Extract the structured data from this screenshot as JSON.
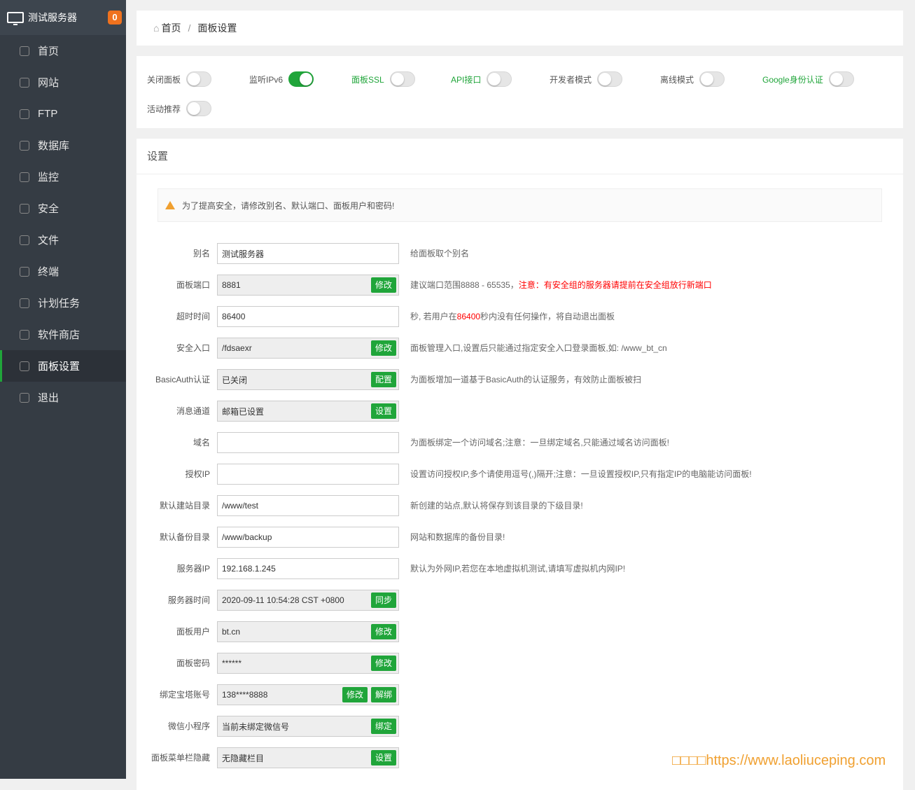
{
  "sidebar": {
    "server_name": "测试服务器",
    "badge": "0",
    "items": [
      {
        "label": "首页",
        "icon": "home-icon"
      },
      {
        "label": "网站",
        "icon": "globe-icon"
      },
      {
        "label": "FTP",
        "icon": "ftp-icon"
      },
      {
        "label": "数据库",
        "icon": "database-icon"
      },
      {
        "label": "监控",
        "icon": "monitor-icon"
      },
      {
        "label": "安全",
        "icon": "shield-icon"
      },
      {
        "label": "文件",
        "icon": "folder-icon"
      },
      {
        "label": "终端",
        "icon": "terminal-icon"
      },
      {
        "label": "计划任务",
        "icon": "calendar-icon"
      },
      {
        "label": "软件商店",
        "icon": "grid-icon"
      },
      {
        "label": "面板设置",
        "icon": "gear-icon",
        "active": true
      },
      {
        "label": "退出",
        "icon": "logout-icon"
      }
    ]
  },
  "breadcrumb": {
    "home": "首页",
    "sep": "/",
    "current": "面板设置"
  },
  "toggles": [
    {
      "label": "关闭面板",
      "on": false,
      "green": false
    },
    {
      "label": "监听IPv6",
      "on": true,
      "green": false
    },
    {
      "label": "面板SSL",
      "on": false,
      "green": true
    },
    {
      "label": "API接口",
      "on": false,
      "green": true
    },
    {
      "label": "开发者模式",
      "on": false,
      "green": false
    },
    {
      "label": "离线模式",
      "on": false,
      "green": false
    },
    {
      "label": "Google身份认证",
      "on": false,
      "green": true
    },
    {
      "label": "活动推荐",
      "on": false,
      "green": false
    }
  ],
  "settings": {
    "title": "设置",
    "alert": "为了提高安全，请修改别名、默认端口、面板用户和密码!",
    "rows": [
      {
        "label": "别名",
        "value": "测试服务器",
        "ro": false,
        "buttons": [],
        "help": [
          {
            "t": "给面板取个别名"
          }
        ]
      },
      {
        "label": "面板端口",
        "value": "8881",
        "ro": true,
        "buttons": [
          "修改"
        ],
        "help": [
          {
            "t": "建议端口范围8888 - 65535，"
          },
          {
            "t": "注意：有安全组的服务器请提前在安全组放行新端口",
            "red": true
          }
        ]
      },
      {
        "label": "超时时间",
        "value": "86400",
        "ro": false,
        "buttons": [],
        "help": [
          {
            "t": " 秒, 若用户在"
          },
          {
            "t": "86400",
            "red": true
          },
          {
            "t": "秒内没有任何操作，将自动退出面板"
          }
        ]
      },
      {
        "label": "安全入口",
        "value": "/fdsaexr",
        "ro": true,
        "buttons": [
          "修改"
        ],
        "help": [
          {
            "t": "面板管理入口,设置后只能通过指定安全入口登录面板,如: /www_bt_cn"
          }
        ]
      },
      {
        "label": "BasicAuth认证",
        "value": "已关闭",
        "ro": true,
        "buttons": [
          "配置"
        ],
        "help": [
          {
            "t": "为面板增加一道基于BasicAuth的认证服务，有效防止面板被扫"
          }
        ]
      },
      {
        "label": "消息通道",
        "value": "邮箱已设置",
        "ro": true,
        "buttons": [
          "设置"
        ],
        "help": []
      },
      {
        "label": "域名",
        "value": "",
        "ro": false,
        "buttons": [],
        "help": [
          {
            "t": "为面板绑定一个访问域名;注意：一旦绑定域名,只能通过域名访问面板!"
          }
        ]
      },
      {
        "label": "授权IP",
        "value": "",
        "ro": false,
        "buttons": [],
        "help": [
          {
            "t": "设置访问授权IP,多个请使用逗号(,)隔开;注意：一旦设置授权IP,只有指定IP的电脑能访问面板!"
          }
        ]
      },
      {
        "label": "默认建站目录",
        "value": "/www/test",
        "ro": false,
        "buttons": [],
        "help": [
          {
            "t": "新创建的站点,默认将保存到该目录的下级目录!"
          }
        ]
      },
      {
        "label": "默认备份目录",
        "value": "/www/backup",
        "ro": false,
        "buttons": [],
        "help": [
          {
            "t": "网站和数据库的备份目录!"
          }
        ]
      },
      {
        "label": "服务器IP",
        "value": "192.168.1.245",
        "ro": false,
        "buttons": [],
        "help": [
          {
            "t": "默认为外网IP,若您在本地虚拟机测试,请填写虚拟机内网IP!"
          }
        ]
      },
      {
        "label": "服务器时间",
        "value": "2020-09-11 10:54:28 CST +0800",
        "ro": true,
        "buttons": [
          "同步"
        ],
        "help": []
      },
      {
        "label": "面板用户",
        "value": "bt.cn",
        "ro": true,
        "buttons": [
          "修改"
        ],
        "help": []
      },
      {
        "label": "面板密码",
        "value": "******",
        "ro": true,
        "buttons": [
          "修改"
        ],
        "help": []
      },
      {
        "label": "绑定宝塔账号",
        "value": "138****8888",
        "ro": true,
        "buttons": [
          "修改",
          "解绑"
        ],
        "help": []
      },
      {
        "label": "微信小程序",
        "value": "当前未绑定微信号",
        "ro": true,
        "buttons": [
          "绑定"
        ],
        "help": []
      },
      {
        "label": "面板菜单栏隐藏",
        "value": "无隐藏栏目",
        "ro": true,
        "buttons": [
          "设置"
        ],
        "help": []
      }
    ]
  },
  "watermark": "□□□□https://www.laoliuceping.com",
  "colors": {
    "accent": "#20a53a",
    "sidebar": "#353c44",
    "badge": "#f0721e",
    "warn": "#f00"
  }
}
